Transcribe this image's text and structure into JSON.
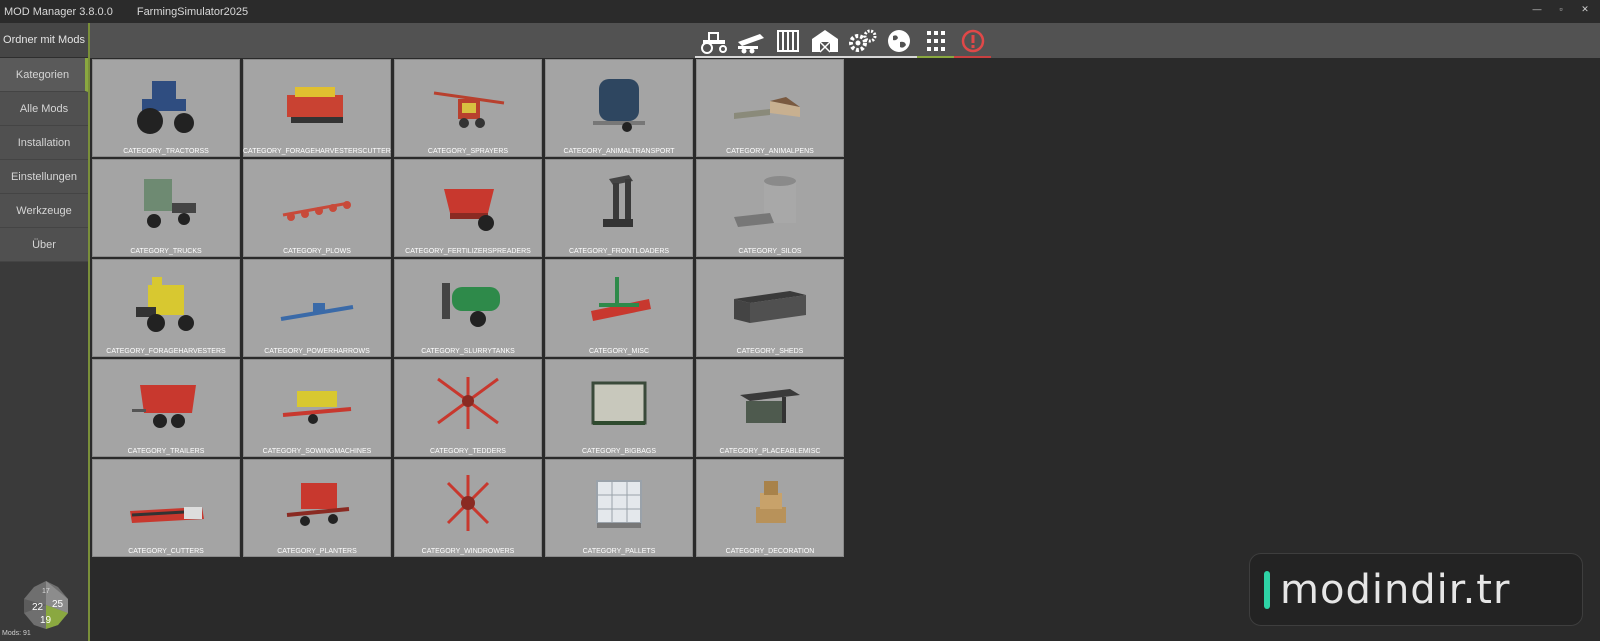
{
  "window": {
    "app_title": "MOD Manager 3.8.0.0",
    "game_title": "FarmingSimulator2025",
    "controls": [
      "—",
      "▫",
      "✕"
    ]
  },
  "sidebar": {
    "folder_button": "Ordner mit Mods",
    "items": [
      {
        "label": "Kategorien",
        "active": true
      },
      {
        "label": "Alle Mods"
      },
      {
        "label": "Installation"
      },
      {
        "label": "Einstellungen"
      },
      {
        "label": "Werkzeuge"
      },
      {
        "label": "Über"
      }
    ],
    "logo_numbers": [
      "22",
      "25",
      "19",
      "17"
    ],
    "mods_count": "Mods: 91"
  },
  "toolbar": {
    "icons": [
      "tractor-icon",
      "trailer-icon",
      "pallet-icon",
      "barn-icon",
      "gears-icon",
      "globe-icon",
      "grid-icon",
      "warning-icon"
    ]
  },
  "categories": [
    "CATEGORY_TRACTORSS",
    "CATEGORY_FORAGEHARVESTERSCUTTERS",
    "CATEGORY_SPRAYERS",
    "CATEGORY_ANIMALTRANSPORT",
    "CATEGORY_ANIMALPENS",
    "CATEGORY_TRUCKS",
    "CATEGORY_PLOWS",
    "CATEGORY_FERTILIZERSPREADERS",
    "CATEGORY_FRONTLOADERS",
    "CATEGORY_SILOS",
    "CATEGORY_FORAGEHARVESTERS",
    "CATEGORY_POWERHARROWS",
    "CATEGORY_SLURRYTANKS",
    "CATEGORY_MISC",
    "CATEGORY_SHEDS",
    "CATEGORY_TRAILERS",
    "CATEGORY_SOWINGMACHINES",
    "CATEGORY_TEDDERS",
    "CATEGORY_BIGBAGS",
    "CATEGORY_PLACEABLEMISC",
    "CATEGORY_CUTTERS",
    "CATEGORY_PLANTERS",
    "CATEGORY_WINDROWERS",
    "CATEGORY_PALLETS",
    "CATEGORY_DECORATION"
  ],
  "watermark": "modindir.tr"
}
